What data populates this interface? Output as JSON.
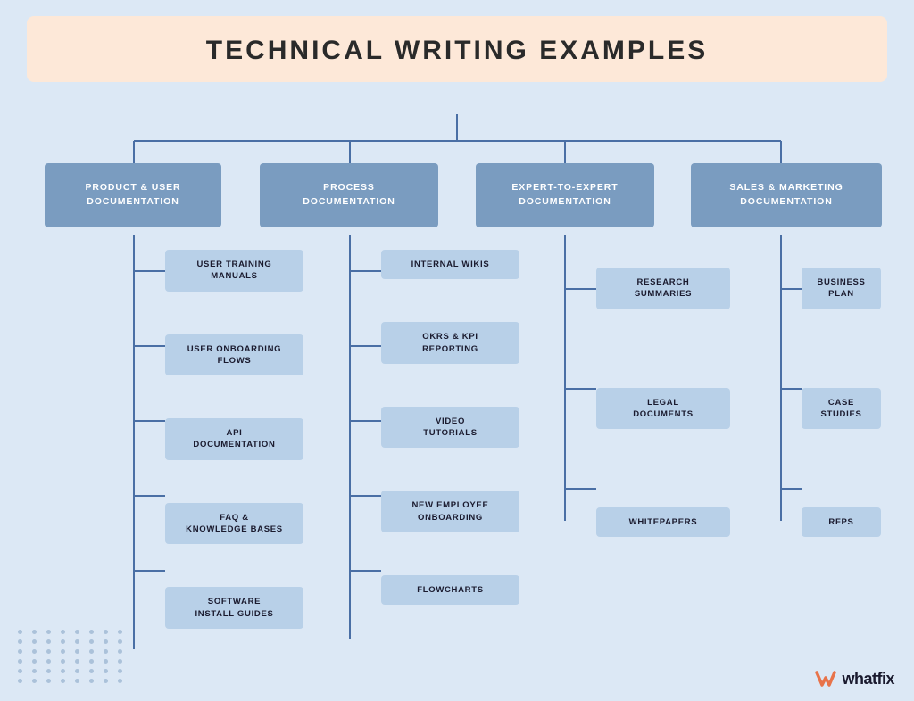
{
  "page": {
    "title": "TECHNICAL WRITING EXAMPLES",
    "bg_color": "#dce8f5",
    "header_bg": "#fde8d8"
  },
  "columns": [
    {
      "id": "col1",
      "label": "PRODUCT & USER\nDOCUMENTATION",
      "items": [
        "USER TRAINING\nMANUALS",
        "USER ONBOARDING\nFLOWS",
        "API\nDOCUMENTATION",
        "FAQ &\nKNOWLEDGE BASES",
        "SOFTWARE\nINSTALL GUIDES"
      ]
    },
    {
      "id": "col2",
      "label": "PROCESS\nDOCUMENTATION",
      "items": [
        "INTERNAL WIKIS",
        "OKRS & KPI\nREPORTING",
        "VIDEO\nTUTORIALS",
        "NEW EMPLOYEE\nONBOARDING",
        "FLOWCHARTS"
      ]
    },
    {
      "id": "col3",
      "label": "EXPERT-TO-EXPERT\nDOCUMENTATION",
      "items": [
        "RESEARCH\nSUMMARIES",
        "LEGAL\nDOCUMENTS",
        "WHITEPAPERS"
      ]
    },
    {
      "id": "col4",
      "label": "SALES & MARKETING\nDOCUMENTATION",
      "items": [
        "BUSINESS PLAN",
        "CASE STUDIES",
        "RFPS"
      ]
    }
  ],
  "logo": {
    "text": "whatfix",
    "mark": "W"
  },
  "colors": {
    "category_bg": "#7a9cc0",
    "item_bg": "#b8d0e8",
    "line": "#4a6fa5",
    "text_cat": "#ffffff",
    "text_item": "#1a1a2e"
  }
}
